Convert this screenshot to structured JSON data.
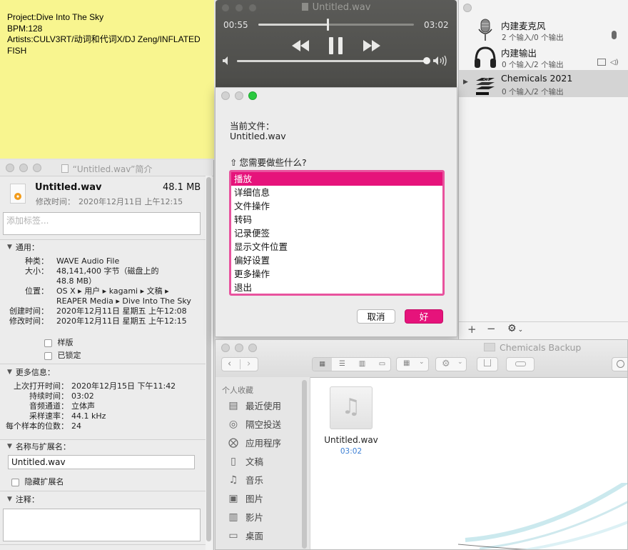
{
  "sticky": {
    "lines": [
      "Project:Dive Into The Sky",
      "BPM:128",
      "Artists:CULV3RT/动词和代词X/DJ Zeng/INFLATED",
      "FISH"
    ]
  },
  "info": {
    "title": "“Untitled.wav”简介",
    "filename": "Untitled.wav",
    "size": "48.1 MB",
    "modified_label": "修改时间：",
    "modified_value": "2020年12月11日 上午12:15",
    "tags_placeholder": "添加标签...",
    "general": {
      "header": "通用：",
      "kind_k": "种类：",
      "kind_v": "WAVE Audio File",
      "size_k": "大小：",
      "size_v1": "48,141,400 字节（磁盘上的",
      "size_v2": "48.8 MB）",
      "where_k": "位置：",
      "where_v1": "OS X ▸ 用户 ▸ kagami ▸ 文稿 ▸",
      "where_v2": "REAPER Media ▸ Dive Into The Sky",
      "created_k": "创建时间：",
      "created_v": "2020年12月11日 星期五 上午12:08",
      "modified_k": "修改时间：",
      "modified_v": "2020年12月11日 星期五 上午12:15",
      "stationery": "样版",
      "locked": "已锁定"
    },
    "more": {
      "header": "更多信息：",
      "last_opened_k": "上次打开时间：",
      "last_opened_v": "2020年12月15日 下午11:42",
      "duration_k": "持续时间：",
      "duration_v": "03:02",
      "channels_k": "音频通道：",
      "channels_v": "立体声",
      "rate_k": "采样速率：",
      "rate_v": "44.1 kHz",
      "bits_k": "每个样本的位数：",
      "bits_v": "24"
    },
    "name_ext": {
      "header": "名称与扩展名：",
      "value": "Untitled.wav",
      "hide_ext": "隐藏扩展名"
    },
    "comments": {
      "header": "注释："
    }
  },
  "player": {
    "title": "Untitled.wav",
    "elapsed": "00:55",
    "total": "03:02",
    "progress": 0.445,
    "volume": 1.0
  },
  "devices": [
    {
      "name": "内建麦克风",
      "sub": "2 个输入/0 个输出",
      "icon": "microphone-icon"
    },
    {
      "name": "内建输出",
      "sub": "0 个输入/2 个输出",
      "icon": "headphones-icon"
    },
    {
      "name": "Chemicals 2021",
      "sub": "0 个输入/2 个输出",
      "icon": "aggregate-device-icon",
      "selected": true
    }
  ],
  "dialog": {
    "current_file_label": "当前文件：",
    "current_file": "Untitled.wav",
    "question": "您需要做些什么?",
    "options": [
      "播放",
      "详细信息",
      "文件操作",
      "转码",
      "记录便签",
      "显示文件位置",
      "偏好设置",
      "更多操作",
      "退出"
    ],
    "selected_index": 0,
    "cancel": "取消",
    "ok": "好"
  },
  "finder": {
    "title": "Chemicals Backup",
    "sidebar_header": "个人收藏",
    "sidebar": [
      {
        "label": "最近使用",
        "icon": "recents-icon"
      },
      {
        "label": "隔空投送",
        "icon": "airdrop-icon"
      },
      {
        "label": "应用程序",
        "icon": "applications-icon"
      },
      {
        "label": "文稿",
        "icon": "documents-icon"
      },
      {
        "label": "音乐",
        "icon": "music-icon"
      },
      {
        "label": "图片",
        "icon": "pictures-icon"
      },
      {
        "label": "影片",
        "icon": "movies-icon"
      },
      {
        "label": "桌面",
        "icon": "desktop-icon"
      }
    ],
    "file": {
      "name": "Untitled.wav",
      "duration": "03:02"
    }
  },
  "colors": {
    "accent": "#e6137b",
    "sticky": "#f8f58f",
    "player": "#545451"
  }
}
